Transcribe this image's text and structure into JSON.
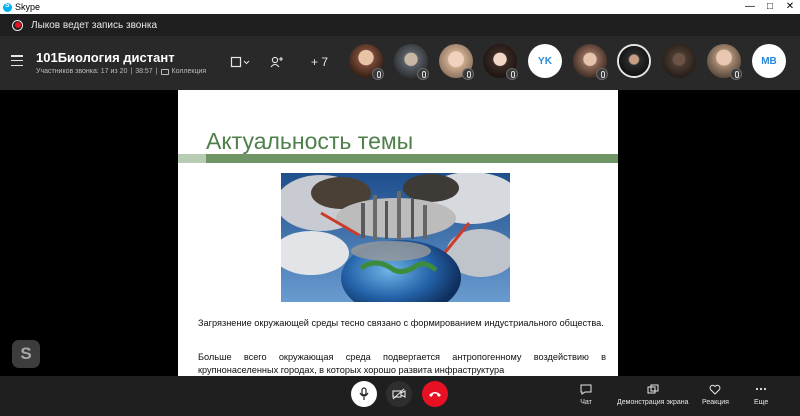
{
  "window": {
    "title": "Skype",
    "controls": [
      "—",
      "□",
      "✕"
    ]
  },
  "recording": {
    "text": "Лыков ведет запись звонка"
  },
  "call": {
    "title": "101Биология дистант",
    "participants_label": "Участников звонка: 17 из 20",
    "duration": "38:57",
    "collection_label": "Коллекция",
    "more_count": "+ 7"
  },
  "participants": [
    {
      "type": "photo",
      "color": "#7a4a3a",
      "muted": true
    },
    {
      "type": "photo",
      "color": "#5a5f66",
      "muted": true
    },
    {
      "type": "photo",
      "color": "#c9a98c",
      "muted": true
    },
    {
      "type": "photo",
      "color": "#3b2a24",
      "muted": true
    },
    {
      "type": "initials",
      "initials": "YK",
      "muted": false
    },
    {
      "type": "photo",
      "color": "#8e6a58",
      "muted": true
    },
    {
      "type": "photo",
      "color": "#2a2a2a",
      "muted": false
    },
    {
      "type": "photo",
      "color": "#4a3a30",
      "muted": false
    },
    {
      "type": "photo",
      "color": "#a78a72",
      "muted": true
    },
    {
      "type": "initials",
      "initials": "MB",
      "muted": false
    }
  ],
  "slide": {
    "title": "Актуальность темы",
    "paragraph1": "Загрязнение окружающей среды тесно связано с формированием индустриального общества.",
    "paragraph2": "Больше всего окружающая среда подвергается антропогенному воздействию в крупнонаселенных городах, в которых хорошо развита инфраструктура"
  },
  "toolbar": {
    "chat_label": "Чат",
    "share_label": "Демонстрация экрана",
    "reaction_label": "Реакция",
    "more_label": "Еще"
  },
  "colors": {
    "accent": "#2b88d8",
    "end_call": "#e81123",
    "slide_green": "#4f7f4a"
  }
}
